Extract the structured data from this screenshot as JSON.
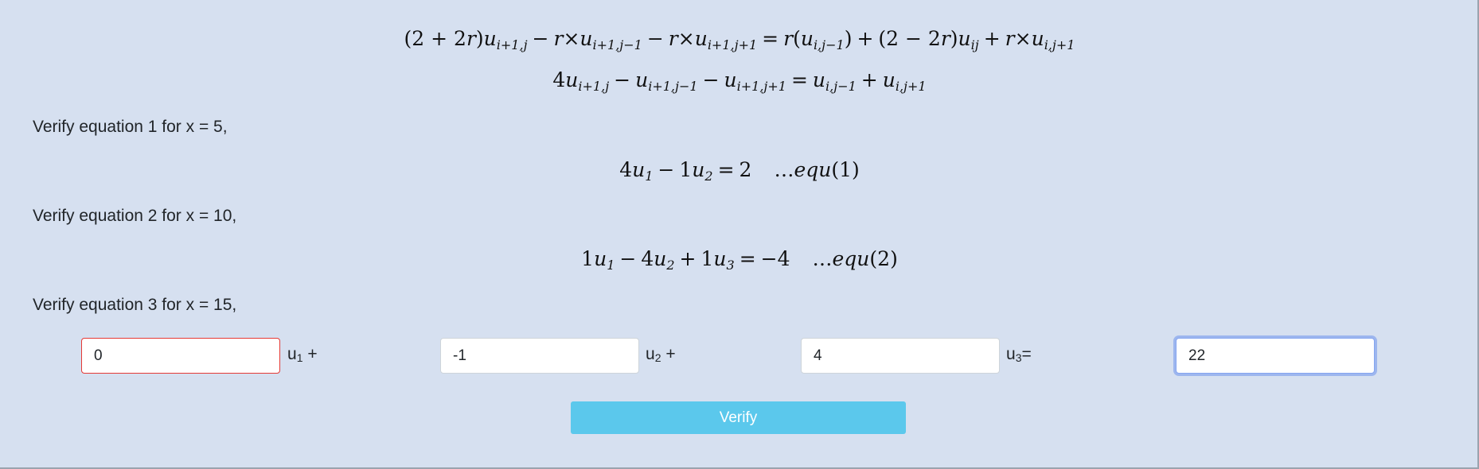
{
  "heading_equations": {
    "eq_a": "(2 + 2r)u_{i+1,j} − r×u_{i+1,j−1} − r×u_{i+1,j+1} = r(u_{i,j−1}) + (2 − 2r)u_{ij} + r×u_{i,j+1}",
    "eq_b": "4u_{i+1,j} − u_{i+1,j−1} − u_{i+1,j+1} = u_{i,j−1} + u_{i,j+1}"
  },
  "steps": [
    {
      "prompt": "Verify equation 1 for x = 5,",
      "equation": "4u1 − 1u2 = 2 ...equ(1)"
    },
    {
      "prompt": "Verify equation 2 for x = 10,",
      "equation": "1u1 − 4u2 + 1u3 = −4 ...equ(2)"
    },
    {
      "prompt": "Verify equation 3 for x = 15,"
    }
  ],
  "inputs": {
    "coef_u1": {
      "value": "0",
      "label_var": "u",
      "label_sub": "1",
      "label_op": " +"
    },
    "coef_u2": {
      "value": "-1",
      "label_var": "u",
      "label_sub": "2",
      "label_op": " +"
    },
    "coef_u3": {
      "value": "4",
      "label_var": "u",
      "label_sub": "3",
      "label_op": "="
    },
    "rhs": {
      "value": "22"
    }
  },
  "buttons": {
    "verify_label": "Verify"
  },
  "colors": {
    "background": "#d6e0f0",
    "button": "#5bc8ec",
    "invalid_border": "#e53935",
    "focus_ring": "#86a6f0"
  }
}
